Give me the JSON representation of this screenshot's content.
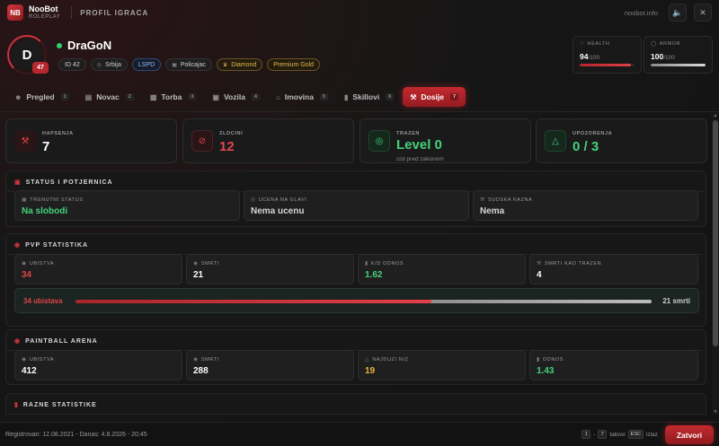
{
  "app": {
    "logo": "NB",
    "brand_name": "NooBot",
    "brand_sub": "ROLEPLAY",
    "page_title": "PROFIL IGRACA",
    "site_url": "noobot.info"
  },
  "icons": {
    "sound": "speaker-icon",
    "close": "close-icon"
  },
  "profile": {
    "avatar_letter": "D",
    "level": "47",
    "name": "DraGoN",
    "online_color": "#2fcf6a",
    "tags": [
      {
        "label": "ID 42",
        "icon": ""
      },
      {
        "label": "Srbija",
        "icon": "globe-icon"
      },
      {
        "label": "LSPD",
        "icon": ""
      },
      {
        "label": "Policajac",
        "icon": "briefcase-icon"
      },
      {
        "label": "Diamond",
        "icon": "crown-icon"
      },
      {
        "label": "Premium Gold",
        "icon": ""
      }
    ],
    "health": {
      "label": "HEALTH",
      "value": "94",
      "max": "/100",
      "fraction": 0.94
    },
    "armor": {
      "label": "ARMOR",
      "value": "100",
      "max": "/100",
      "fraction": 1.0
    }
  },
  "tabs": [
    {
      "label": "Pregled",
      "num": "1",
      "icon": "user-icon"
    },
    {
      "label": "Novac",
      "num": "2",
      "icon": "wallet-icon"
    },
    {
      "label": "Torba",
      "num": "3",
      "icon": "bag-icon"
    },
    {
      "label": "Vozila",
      "num": "4",
      "icon": "car-icon"
    },
    {
      "label": "Imovina",
      "num": "5",
      "icon": "house-icon"
    },
    {
      "label": "Skillovi",
      "num": "6",
      "icon": "chart-icon"
    },
    {
      "label": "Dosije",
      "num": "7",
      "icon": "gavel-icon",
      "active": true
    }
  ],
  "summary": [
    {
      "label": "HAPSENJA",
      "value": "7",
      "sub": "",
      "icon": "gavel-icon",
      "color": "#ffffff"
    },
    {
      "label": "ZLOCINI",
      "value": "12",
      "sub": "",
      "icon": "ban-icon",
      "color": "#e0454c"
    },
    {
      "label": "TRAZEN",
      "value": "Level 0",
      "sub": "cist pred zakonom",
      "icon": "target-icon",
      "color": "#44d27a"
    },
    {
      "label": "UPOZORENJA",
      "value": "0 / 3",
      "sub": "",
      "icon": "warning-icon",
      "color": "#44d27a"
    }
  ],
  "status": {
    "title": "STATUS I POTJERNICA",
    "cells": [
      {
        "label": "TRENUTNI STATUS",
        "value": "Na slobodi"
      },
      {
        "label": "UCENA NA GLAVI",
        "value": "Nema ucenu"
      },
      {
        "label": "SUDSKA KAZNA",
        "value": "Nema"
      }
    ]
  },
  "pvp": {
    "title": "PVP STATISTIKA",
    "cells": [
      {
        "label": "UBISTVA",
        "value": "34"
      },
      {
        "label": "SMRTI",
        "value": "21"
      },
      {
        "label": "K/D ODNOS",
        "value": "1.62"
      },
      {
        "label": "SMRTI KAO TRAZEN",
        "value": "4"
      }
    ],
    "ratio_left": "34 ubistava",
    "ratio_right": "21 smrti",
    "ratio_fraction": 0.618
  },
  "paintball": {
    "title": "PAINTBALL ARENA",
    "cells": [
      {
        "label": "UBISTVA",
        "value": "412"
      },
      {
        "label": "SMRTI",
        "value": "288"
      },
      {
        "label": "NAJDUZI NIZ",
        "value": "19"
      },
      {
        "label": "ODNOS",
        "value": "1.43"
      }
    ]
  },
  "misc": {
    "title": "RAZNE STATISTIKE"
  },
  "footer": {
    "registered": "Registrovan: 12.08.2021 - Danas: 4.8.2026 - 20:45",
    "key_start": "1",
    "key_sep": "-",
    "key_end": "7",
    "tabs_hint": "tabovi",
    "esc_key": "ESC",
    "esc_hint": "izlaz",
    "close_label": "Zatvori"
  }
}
